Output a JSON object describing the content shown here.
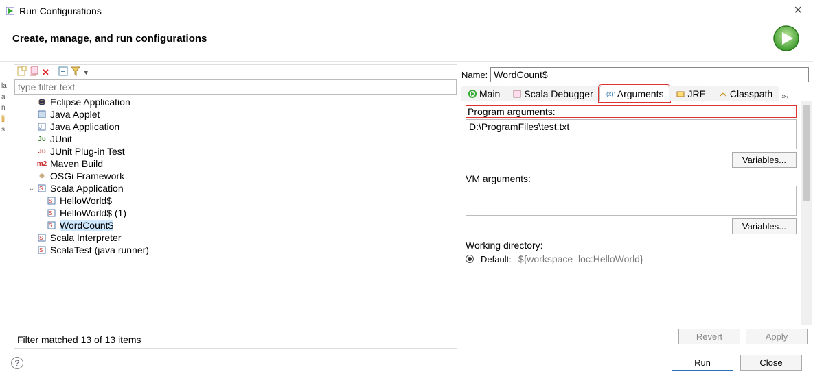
{
  "window": {
    "title": "Run Configurations"
  },
  "header": {
    "title": "Create, manage, and run configurations"
  },
  "leftPanel": {
    "filter_placeholder": "type filter text",
    "filter_status": "Filter matched 13 of 13 items",
    "items": [
      {
        "label": "Eclipse Application",
        "icon": "eclipse"
      },
      {
        "label": "Java Applet",
        "icon": "applet"
      },
      {
        "label": "Java Application",
        "icon": "java"
      },
      {
        "label": "JUnit",
        "icon": "ju"
      },
      {
        "label": "JUnit Plug-in Test",
        "icon": "ju"
      },
      {
        "label": "Maven Build",
        "icon": "m2"
      },
      {
        "label": "OSGi Framework",
        "icon": "osgi"
      }
    ],
    "scala": {
      "label": "Scala Application",
      "children": [
        {
          "label": "HelloWorld$"
        },
        {
          "label": "HelloWorld$ (1)"
        },
        {
          "label": "WordCount$",
          "selected": true
        }
      ]
    },
    "tail": [
      {
        "label": "Scala Interpreter"
      },
      {
        "label": "ScalaTest (java runner)"
      }
    ]
  },
  "rightPanel": {
    "name_label": "Name:",
    "name_value": "WordCount$",
    "tabs": [
      {
        "label": "Main"
      },
      {
        "label": "Scala Debugger"
      },
      {
        "label": "Arguments",
        "active": true,
        "highlighted": true
      },
      {
        "label": "JRE"
      },
      {
        "label": "Classpath"
      }
    ],
    "tabs_overflow": "»₃",
    "arguments": {
      "program_label": "Program arguments:",
      "program_value": "D:\\ProgramFiles\\test.txt",
      "vm_label": "VM arguments:",
      "vm_value": "",
      "variables_label": "Variables...",
      "wd_label": "Working directory:",
      "wd_default_label": "Default:",
      "wd_default_value": "${workspace_loc:HelloWorld}"
    },
    "revert_label": "Revert",
    "apply_label": "Apply"
  },
  "footer": {
    "run_label": "Run",
    "close_label": "Close"
  }
}
